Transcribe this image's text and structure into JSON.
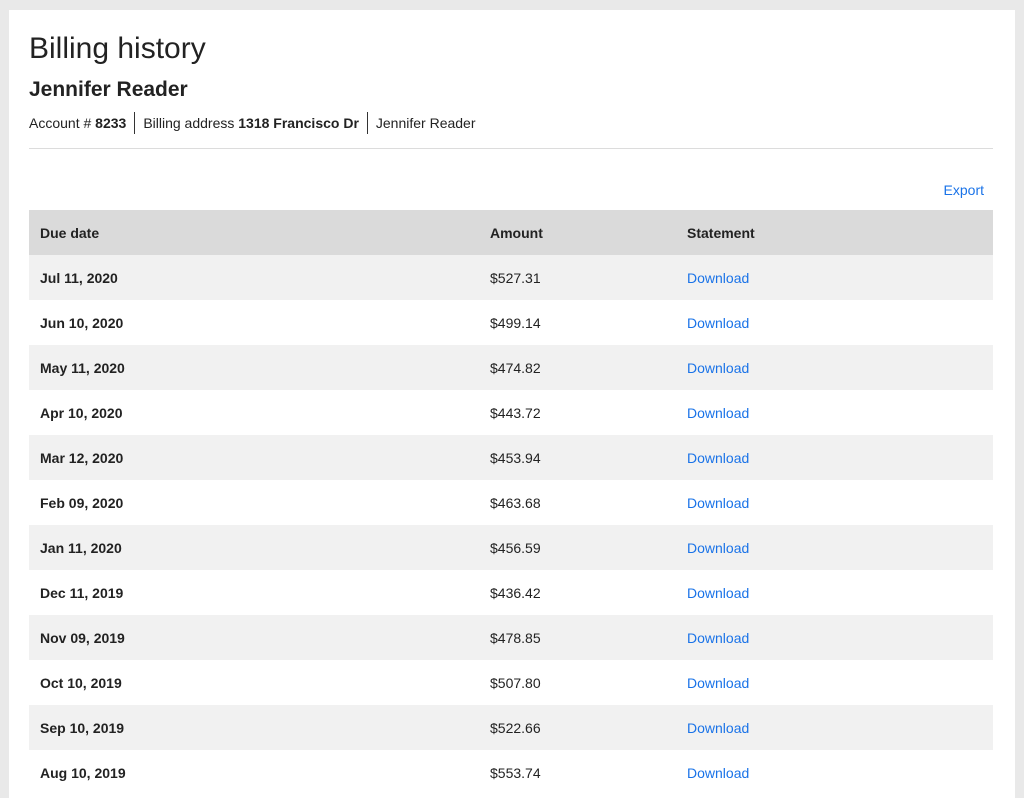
{
  "page": {
    "title": "Billing history",
    "customer_name": "Jennifer Reader"
  },
  "meta": {
    "account_label": "Account #",
    "account_number": "8233",
    "billing_label": "Billing address",
    "billing_address": "1318 Francisco Dr",
    "holder": "Jennifer Reader"
  },
  "actions": {
    "export_label": "Export"
  },
  "table": {
    "headers": {
      "due_date": "Due date",
      "amount": "Amount",
      "statement": "Statement"
    },
    "rows": [
      {
        "due_date": "Jul 11, 2020",
        "amount": "$527.31",
        "statement": "Download"
      },
      {
        "due_date": "Jun 10, 2020",
        "amount": "$499.14",
        "statement": "Download"
      },
      {
        "due_date": "May 11, 2020",
        "amount": "$474.82",
        "statement": "Download"
      },
      {
        "due_date": "Apr 10, 2020",
        "amount": "$443.72",
        "statement": "Download"
      },
      {
        "due_date": "Mar 12, 2020",
        "amount": "$453.94",
        "statement": "Download"
      },
      {
        "due_date": "Feb 09, 2020",
        "amount": "$463.68",
        "statement": "Download"
      },
      {
        "due_date": "Jan 11, 2020",
        "amount": "$456.59",
        "statement": "Download"
      },
      {
        "due_date": "Dec 11, 2019",
        "amount": "$436.42",
        "statement": "Download"
      },
      {
        "due_date": "Nov 09, 2019",
        "amount": "$478.85",
        "statement": "Download"
      },
      {
        "due_date": "Oct 10, 2019",
        "amount": "$507.80",
        "statement": "Download"
      },
      {
        "due_date": "Sep 10, 2019",
        "amount": "$522.66",
        "statement": "Download"
      },
      {
        "due_date": "Aug 10, 2019",
        "amount": "$553.74",
        "statement": "Download"
      }
    ]
  },
  "colors": {
    "link": "#1a73e8",
    "header_bg": "#dadada",
    "stripe_bg": "#f1f1f1",
    "page_bg": "#e9e9e9"
  }
}
